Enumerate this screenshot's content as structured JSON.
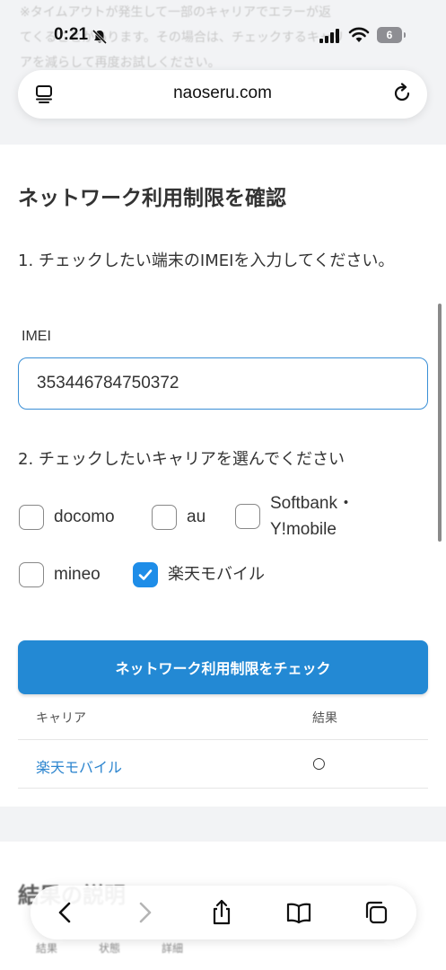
{
  "background_text": [
    "※タイムアウトが発生して一部のキャリアでエラーが返",
    "てくることがあります。その場合は、チェックするキャリ",
    "アを減らして再度お試しください。"
  ],
  "status_bar": {
    "time": "0:21",
    "battery": "6"
  },
  "browser": {
    "url": "naoseru.com"
  },
  "form": {
    "title": "ネットワーク利用制限を確認",
    "step1": "1. チェックしたい端末のIMEIを入力してください。",
    "imei_label": "IMEI",
    "imei_value": "353446784750372",
    "step2": "2. チェックしたいキャリアを選んでください",
    "carriers": [
      {
        "label": "docomo",
        "checked": false
      },
      {
        "label": "au",
        "checked": false
      },
      {
        "label": "Softbank・Y!mobile",
        "checked": false
      },
      {
        "label": "mineo",
        "checked": false
      },
      {
        "label": "楽天モバイル",
        "checked": true
      }
    ],
    "check_button": "ネットワーク利用制限をチェック"
  },
  "results": {
    "headers": {
      "carrier": "キャリア",
      "result": "結果"
    },
    "rows": [
      {
        "carrier": "楽天モバイル",
        "result": "○"
      }
    ]
  },
  "explanation": {
    "title": "結果の説明",
    "columns": [
      "結果",
      "状態",
      "詳細"
    ]
  },
  "colors": {
    "accent": "#2389d4",
    "link": "#2e86cf",
    "page_background": "#f2f3f5"
  }
}
